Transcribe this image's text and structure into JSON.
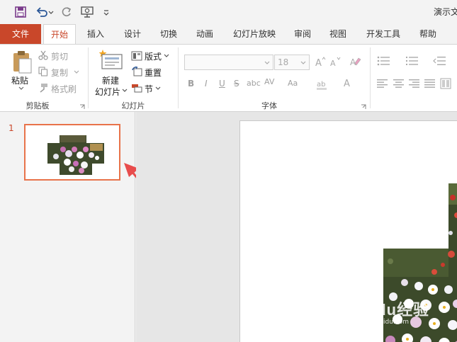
{
  "window": {
    "title": "演示文"
  },
  "quick_access": {
    "icons": [
      "save-icon",
      "undo-icon",
      "redo-icon",
      "present-icon",
      "customize-icon"
    ]
  },
  "tabs": [
    {
      "label": "文件"
    },
    {
      "label": "开始"
    },
    {
      "label": "插入"
    },
    {
      "label": "设计"
    },
    {
      "label": "切换"
    },
    {
      "label": "动画"
    },
    {
      "label": "幻灯片放映"
    },
    {
      "label": "审阅"
    },
    {
      "label": "视图"
    },
    {
      "label": "开发工具"
    },
    {
      "label": "帮助"
    }
  ],
  "ribbon": {
    "clipboard": {
      "paste": "粘贴",
      "cut": "剪切",
      "copy": "复制",
      "format_painter": "格式刷",
      "group": "剪贴板"
    },
    "slides": {
      "new_slide_1": "新建",
      "new_slide_2": "幻灯片",
      "layout": "版式",
      "reset": "重置",
      "section": "节",
      "group": "幻灯片"
    },
    "font": {
      "font_name": "",
      "font_size": "18",
      "group": "字体",
      "bold": "B",
      "italic": "I",
      "underline": "U",
      "strike": "S",
      "shadow": "abc",
      "spacing": "AV",
      "case": "Aa"
    }
  },
  "thumbnail_pane": {
    "slide_number": "1"
  },
  "colors": {
    "accent": "#c9472a",
    "arrow": "#e84c4c",
    "selection": "#e8734a"
  },
  "watermark": {
    "text": "Baidu经验",
    "sub": "jingyan.baidu.com"
  }
}
